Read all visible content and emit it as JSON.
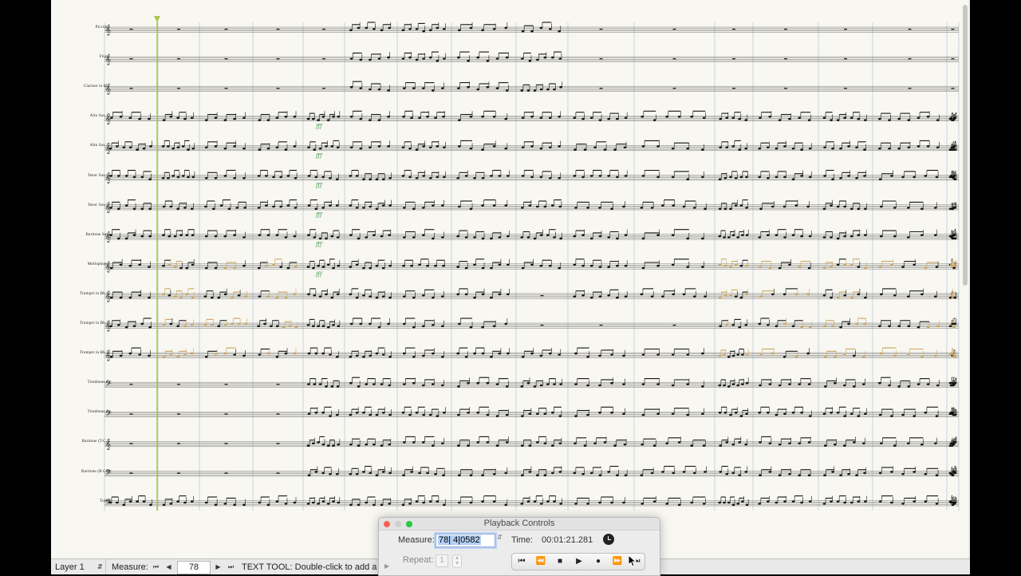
{
  "score": {
    "instruments": [
      "Piccolo",
      "Flute",
      "Clarinet in Bb",
      "Alto Sax 1",
      "Alto Sax 2",
      "Tenor Sax 1",
      "Tenor Sax 2",
      "Baritone Sax",
      "Mellophone",
      "Trumpet in Bb 1",
      "Trumpet in Bb 2",
      "Trumpet in Bb 3",
      "Trombone 1",
      "Trombone 2",
      "Baritone (T.C.)",
      "Baritone (B.C.)",
      "Tuba"
    ]
  },
  "status_bar": {
    "layer": "Layer 1",
    "measure_label": "Measure:",
    "measure_value": "78",
    "tool_hint": "TEXT TOOL: Double-click to add a text block."
  },
  "playback": {
    "title": "Playback Controls",
    "measure_label": "Measure:",
    "measure_value": "78| 4|0582",
    "time_label": "Time:",
    "time_value": "00:01:21.281",
    "repeat_label": "Repeat:",
    "repeat_value": "1"
  },
  "icons": [
    "first-measure-icon",
    "previous-measure-icon",
    "next-measure-icon",
    "last-measure-icon",
    "go-to-start-icon",
    "rewind-icon",
    "stop-icon",
    "play-icon",
    "record-icon",
    "fast-forward-icon",
    "go-to-end-icon",
    "clock-icon"
  ],
  "colors": {
    "playhead": "#a8c64a",
    "highlight_note": "#c9a45c",
    "selection": "#b3cff5",
    "close": "#fc5f57",
    "minimize": "#fdbc2e",
    "zoom": "#28c840"
  }
}
